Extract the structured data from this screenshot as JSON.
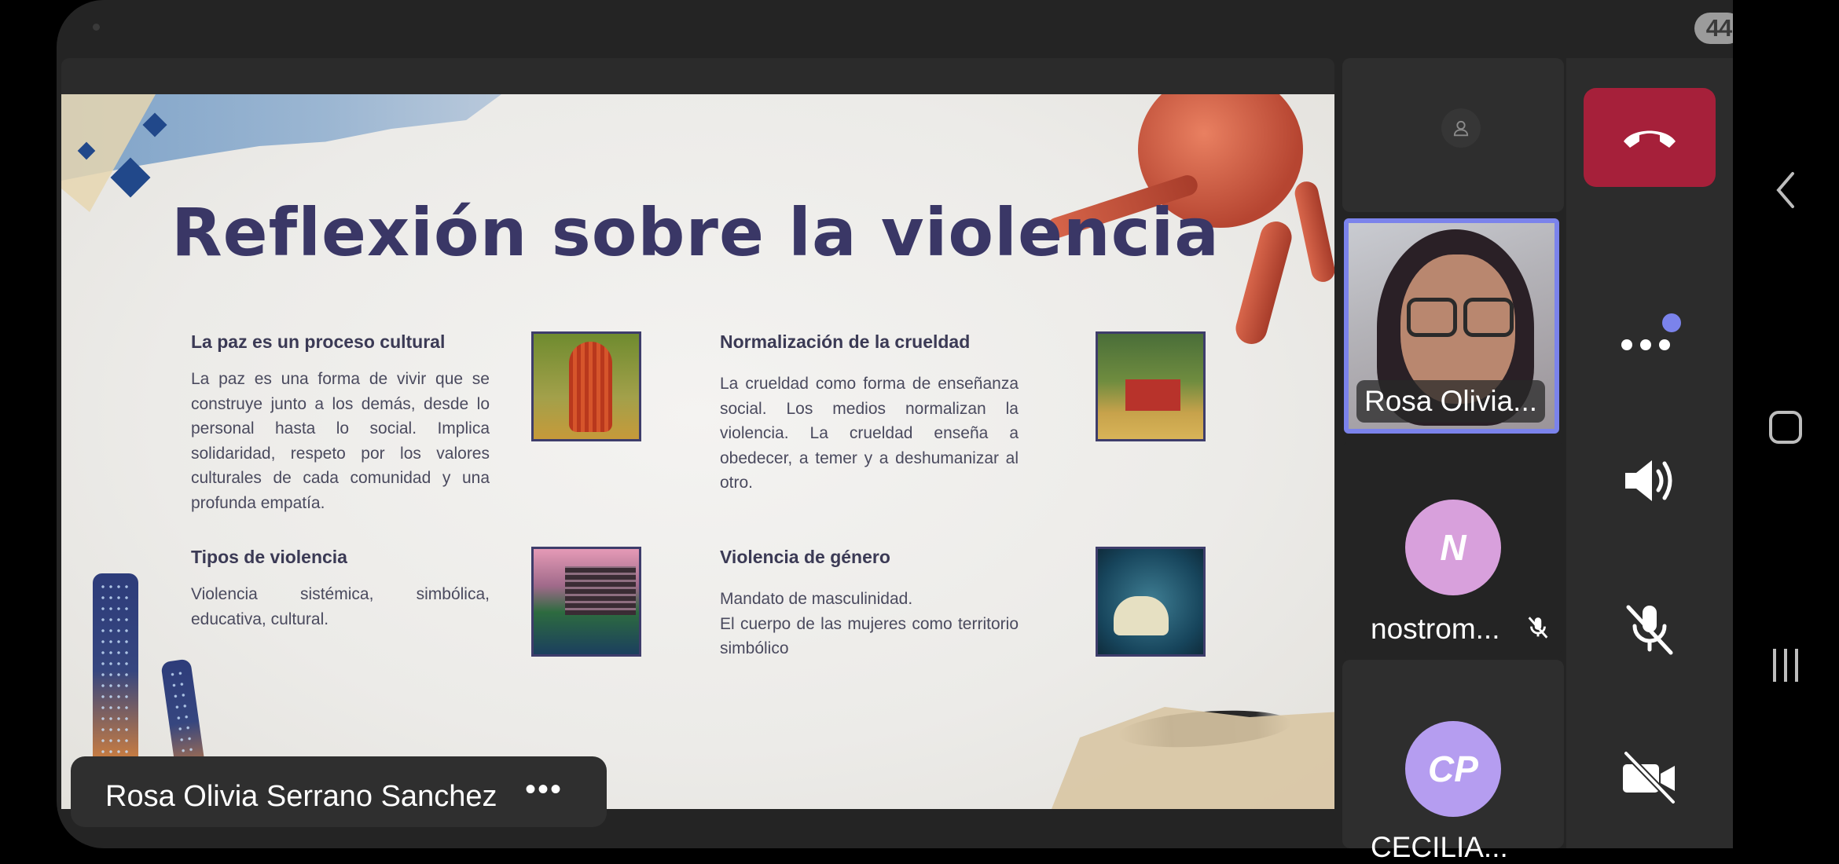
{
  "status": {
    "notification_count": "44"
  },
  "slide": {
    "title": "Reflexión sobre la violencia",
    "sections": [
      {
        "heading": "La paz es un proceso cultural",
        "body": "La paz es una forma de vivir que se construye junto a los demás, desde lo personal hasta lo social. Implica solidaridad, respeto por los valores culturales de cada comunidad y una profunda empatía."
      },
      {
        "heading": "Normalización de la crueldad",
        "body": "La crueldad como forma de enseñanza social. Los medios normalizan la violencia. La crueldad enseña a obedecer, a temer y a deshumanizar al otro."
      },
      {
        "heading": "Tipos de violencia",
        "body": "Violencia sistémica, simbólica, educativa, cultural."
      },
      {
        "heading": "Violencia de género",
        "body_lines": [
          "Mandato de masculinidad.",
          "El cuerpo de las mujeres como territorio simbólico"
        ]
      }
    ]
  },
  "presenter": {
    "name": "Rosa Olivia Serrano Sanchez",
    "more_label": "•••"
  },
  "participants": [
    {
      "name": "Rosa Olivia...",
      "type": "video"
    },
    {
      "name": "nostrom...",
      "initials": "N",
      "avatar_color": "#d8a0dc",
      "muted": true
    },
    {
      "name": "CECILIA...",
      "initials": "CP",
      "avatar_color": "#b59df0",
      "muted": true
    }
  ],
  "colors": {
    "hangup": "#a6203a",
    "accent": "#7b83eb",
    "slide_title": "#3a3766"
  },
  "icons": [
    "hang-up-icon",
    "more-options-icon",
    "speaker-icon",
    "mic-off-icon",
    "camera-off-icon",
    "person-icon",
    "back-icon",
    "home-icon",
    "recents-icon"
  ]
}
